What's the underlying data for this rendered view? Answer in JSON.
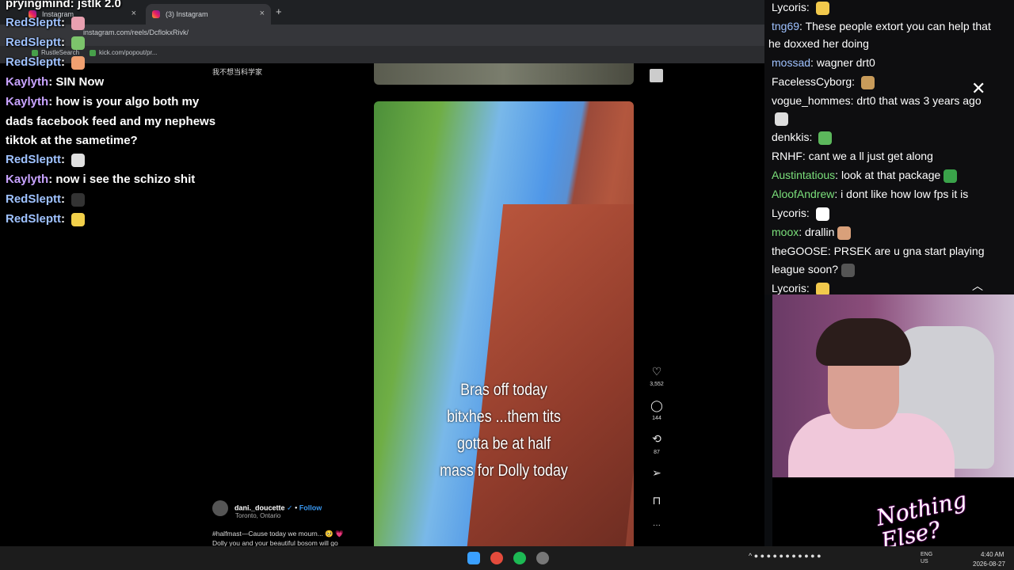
{
  "browser": {
    "tabs": [
      {
        "label": "Instagram"
      },
      {
        "label": "(3) Instagram"
      }
    ],
    "new_tab": "+",
    "close": "×",
    "url": "instagram.com/reels/DcflokxRivk/",
    "bookmarks": [
      {
        "label": "RustleSearch"
      },
      {
        "label": "kick.com/popout/pr..."
      }
    ]
  },
  "left_chat": {
    "top_line": {
      "user": "pryingmind",
      "text": "jstlk 2.0"
    },
    "messages": [
      {
        "user": "RedSleptt",
        "text": "",
        "style": "n",
        "emote": "#e8a0b0"
      },
      {
        "user": "RedSleptt",
        "text": "",
        "style": "n",
        "emote": "#7cc46b"
      },
      {
        "user": "RedSleptt",
        "text": "",
        "style": "n",
        "emote": "#f0a070"
      },
      {
        "user": "Kaylyth",
        "text": "SIN Now",
        "style": "k"
      },
      {
        "user": "Kaylyth",
        "text": "how is your algo both my",
        "style": "k"
      },
      {
        "user": "",
        "text": "dads facebook feed and my nephews",
        "style": ""
      },
      {
        "user": "",
        "text": "tiktok at the sametime?",
        "style": ""
      },
      {
        "user": "RedSleptt",
        "text": "",
        "style": "n",
        "emote": "#e0e0e0"
      },
      {
        "user": "Kaylyth",
        "text": "now i see the schizo shit",
        "style": "k"
      },
      {
        "user": "RedSleptt",
        "text": "",
        "style": "n",
        "emote": "#333"
      },
      {
        "user": "RedSleptt",
        "text": "",
        "style": "n",
        "emote": "#f2d04a"
      }
    ]
  },
  "instagram": {
    "top_note": "我不想当科学家",
    "reel_caption": [
      "Bras off today",
      "bitxhes ...them tits",
      "gotta be at half",
      "mass for Dolly today"
    ],
    "actions": [
      {
        "icon": "♡",
        "count": "3,552",
        "name": "like"
      },
      {
        "icon": "◯",
        "count": "144",
        "name": "comment"
      },
      {
        "icon": "⟲",
        "count": "87",
        "name": "remix"
      },
      {
        "icon": "➢",
        "count": "",
        "name": "share"
      },
      {
        "icon": "⊓",
        "count": "",
        "name": "save"
      },
      {
        "icon": "···",
        "count": "",
        "name": "more"
      }
    ],
    "author": {
      "handle": "dani._doucette",
      "verified": "✓",
      "follow": "Follow",
      "location": "Toronto, Ontario"
    },
    "caption_line1": "#halfmast—Cause today we mourn... 🥺 💗",
    "caption_line2": "Dolly you and your beautiful bosom will go"
  },
  "right_chat": {
    "messages": [
      {
        "user": "Lycoris",
        "color": "#ffffff",
        "text": "",
        "emote": "#f2c94c"
      },
      {
        "user": "tng69",
        "color": "#9fc2ff",
        "text": "These people extort you can help that"
      },
      {
        "user": "",
        "color": "#ffffff",
        "text": "he doxxed her doing"
      },
      {
        "user": "mossad",
        "color": "#9fc2ff",
        "text": "wagner drt0"
      },
      {
        "user": "FacelessCyborg",
        "color": "#ffffff",
        "text": "",
        "emote": "#c89b5a"
      },
      {
        "user": "vogue_hommes",
        "color": "#ffffff",
        "text": "drt0 that was 3 years ago"
      },
      {
        "user": "",
        "color": "#ffffff",
        "text": "",
        "emote": "#dddddd"
      },
      {
        "user": "denkkis",
        "color": "#ffffff",
        "text": "",
        "emote": "#5cb85c"
      },
      {
        "user": "RNHF",
        "color": "#ffffff",
        "text": "cant we a ll just get along"
      },
      {
        "user": "Austintatious",
        "color": "#7be07b",
        "text": "look at that package",
        "emote": "#3aa34a"
      },
      {
        "user": "AloofAndrew",
        "color": "#7be07b",
        "text": "i dont like how low fps it is"
      },
      {
        "user": "Lycoris",
        "color": "#ffffff",
        "text": "",
        "emote": "#ffffff"
      },
      {
        "user": "moox",
        "color": "#7be07b",
        "text": "drallin",
        "emote": "#d9a07a"
      },
      {
        "user": "theGOOSE",
        "color": "#ffffff",
        "text": "PRSEK are u gna start playing"
      },
      {
        "user": "",
        "color": "#ffffff",
        "text": "league soon?",
        "emote": "#555555"
      },
      {
        "user": "Lycoris",
        "color": "#ffffff",
        "text": "",
        "emote": "#f2c94c"
      }
    ],
    "close_icon": "✕",
    "up_icon": "︿"
  },
  "overlay_logo": "Nothing Else?",
  "taskbar": {
    "lang": "ENG\nUS",
    "time": "4:40 AM",
    "date": "2026-08-27"
  }
}
